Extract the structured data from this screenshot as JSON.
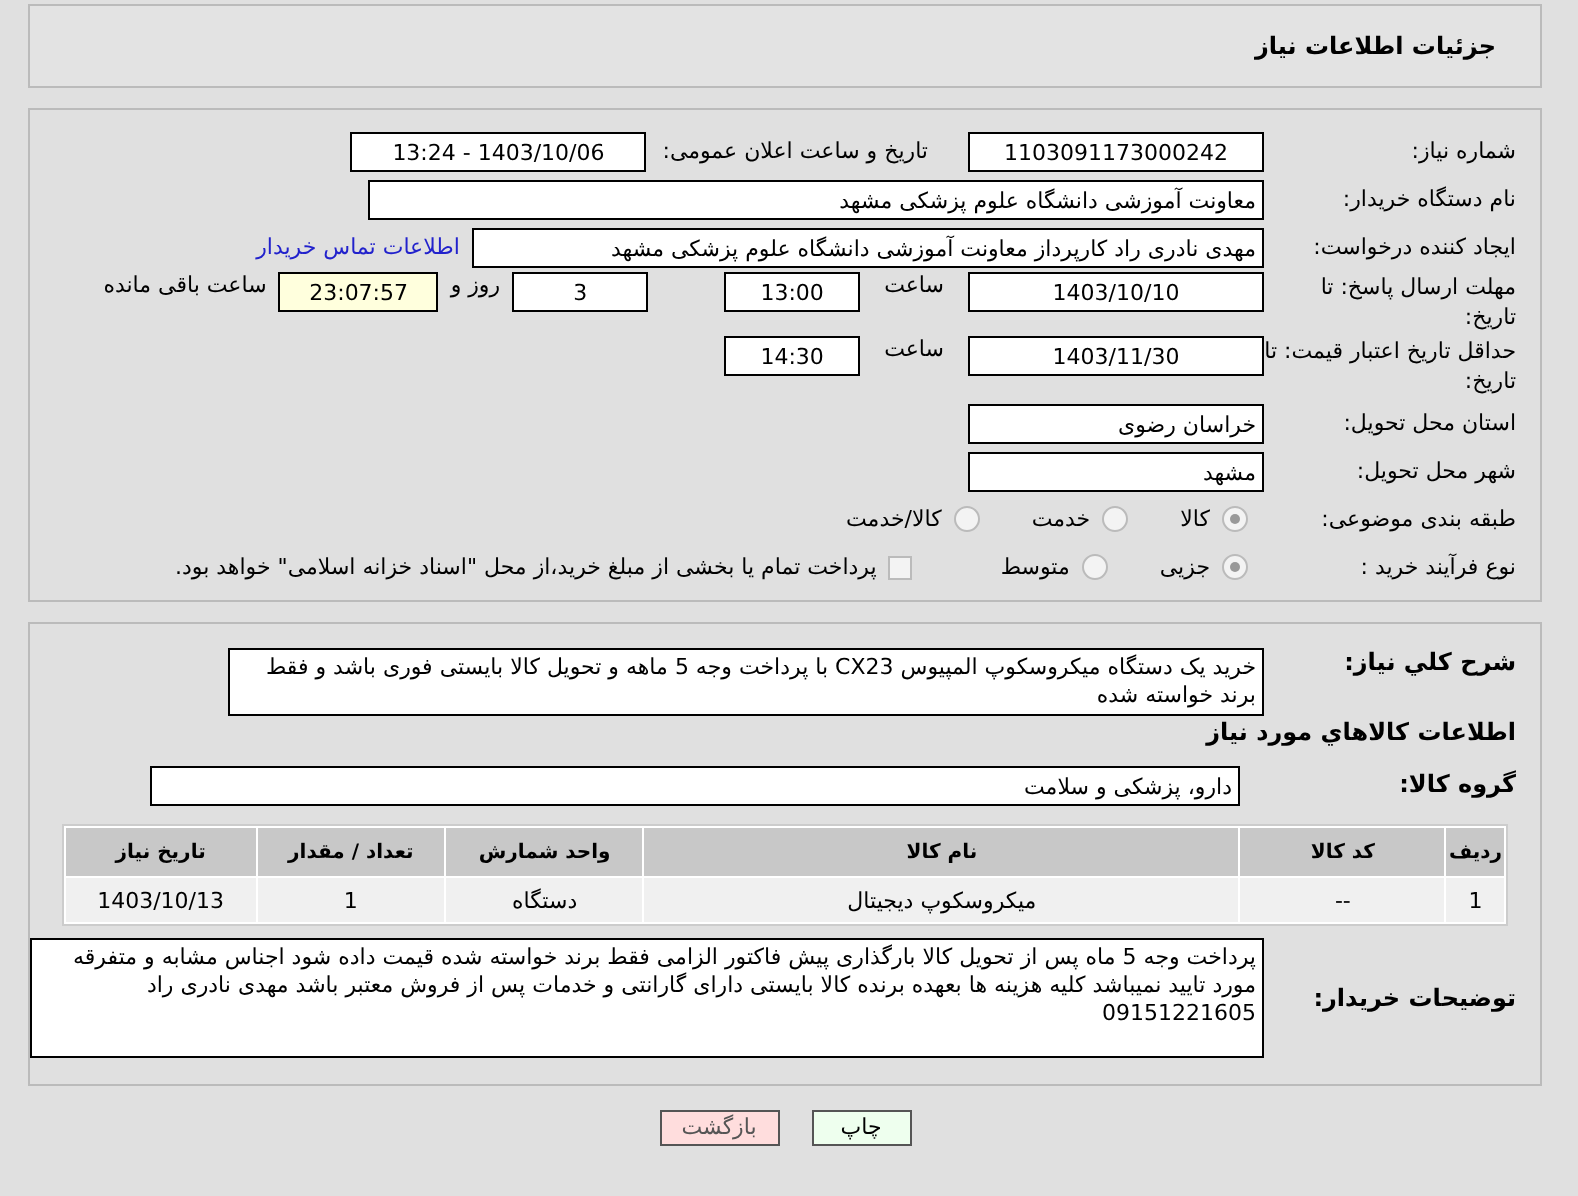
{
  "header": {
    "title": "جزئیات اطلاعات نیاز"
  },
  "need_number": {
    "label": "شماره نیاز:",
    "value": "1103091173000242"
  },
  "announce": {
    "label": "تاریخ و ساعت اعلان عمومی:",
    "value": "1403/10/06 - 13:24"
  },
  "buyer": {
    "label": "نام دستگاه خریدار:",
    "value": "معاونت آموزشی دانشگاه علوم پزشکی مشهد"
  },
  "requester": {
    "label": "ایجاد کننده درخواست:",
    "value": "مهدی نادری راد کارپرداز معاونت آموزشی دانشگاه علوم پزشکی مشهد",
    "link": "اطلاعات تماس خریدار"
  },
  "deadline": {
    "label": "مهلت ارسال پاسخ: تا تاریخ:",
    "date": "1403/10/10",
    "time_label": "ساعت",
    "time": "13:00",
    "days": "3",
    "days_label": "روز و",
    "remaining": "23:07:57",
    "remaining_label": "ساعت باقی مانده"
  },
  "validity": {
    "label": "حداقل تاریخ اعتبار قیمت: تا تاریخ:",
    "date": "1403/11/30",
    "time_label": "ساعت",
    "time": "14:30"
  },
  "province": {
    "label": "استان محل تحویل:",
    "value": "خراسان رضوی"
  },
  "city": {
    "label": "شهر محل تحویل:",
    "value": "مشهد"
  },
  "category": {
    "label": "طبقه بندی موضوعی:",
    "options": [
      {
        "label": "کالا",
        "selected": true
      },
      {
        "label": "خدمت",
        "selected": false
      },
      {
        "label": "کالا/خدمت",
        "selected": false
      }
    ]
  },
  "process": {
    "label": "نوع فرآیند خرید :",
    "options": [
      {
        "label": "جزیی",
        "selected": true
      },
      {
        "label": "متوسط",
        "selected": false
      }
    ],
    "checkbox": {
      "label": "پرداخت تمام یا بخشی از مبلغ خرید،از محل \"اسناد خزانه اسلامی\" خواهد بود.",
      "checked": false
    }
  },
  "summary": {
    "label": "شرح کلي نياز:",
    "value": "خرید یک دستگاه میکروسکوپ المپیوس CX23 با پرداخت وجه 5 ماهه و تحویل کالا بایستی فوری باشد و فقط برند خواسته شده"
  },
  "goods_heading": "اطلاعات کالاهاي مورد نياز",
  "goods_group": {
    "label": "گروه کالا:",
    "value": "دارو، پزشکی و سلامت"
  },
  "table": {
    "columns": [
      "ردیف",
      "کد کالا",
      "نام کالا",
      "واحد شمارش",
      "تعداد / مقدار",
      "تاریخ نیاز"
    ],
    "rows": [
      [
        "1",
        "--",
        "میکروسکوپ دیجیتال",
        "دستگاه",
        "1",
        "1403/10/13"
      ]
    ]
  },
  "notes": {
    "label": "توضیحات خریدار:",
    "value": "پرداخت وجه 5 ماه پس از تحویل کالا بارگذاری پیش فاکتور الزامی فقط برند خواسته شده قیمت داده شود اجناس مشابه و متفرقه مورد تایید نمیباشد کلیه هزینه ها بعهده برنده کالا بایستی دارای گارانتی و خدمات پس از فروش معتبر باشد مهدی نادری راد 09151221605"
  },
  "buttons": [
    {
      "kind": "print",
      "label": "چاپ"
    },
    {
      "kind": "back",
      "label": "بازگشت"
    }
  ]
}
